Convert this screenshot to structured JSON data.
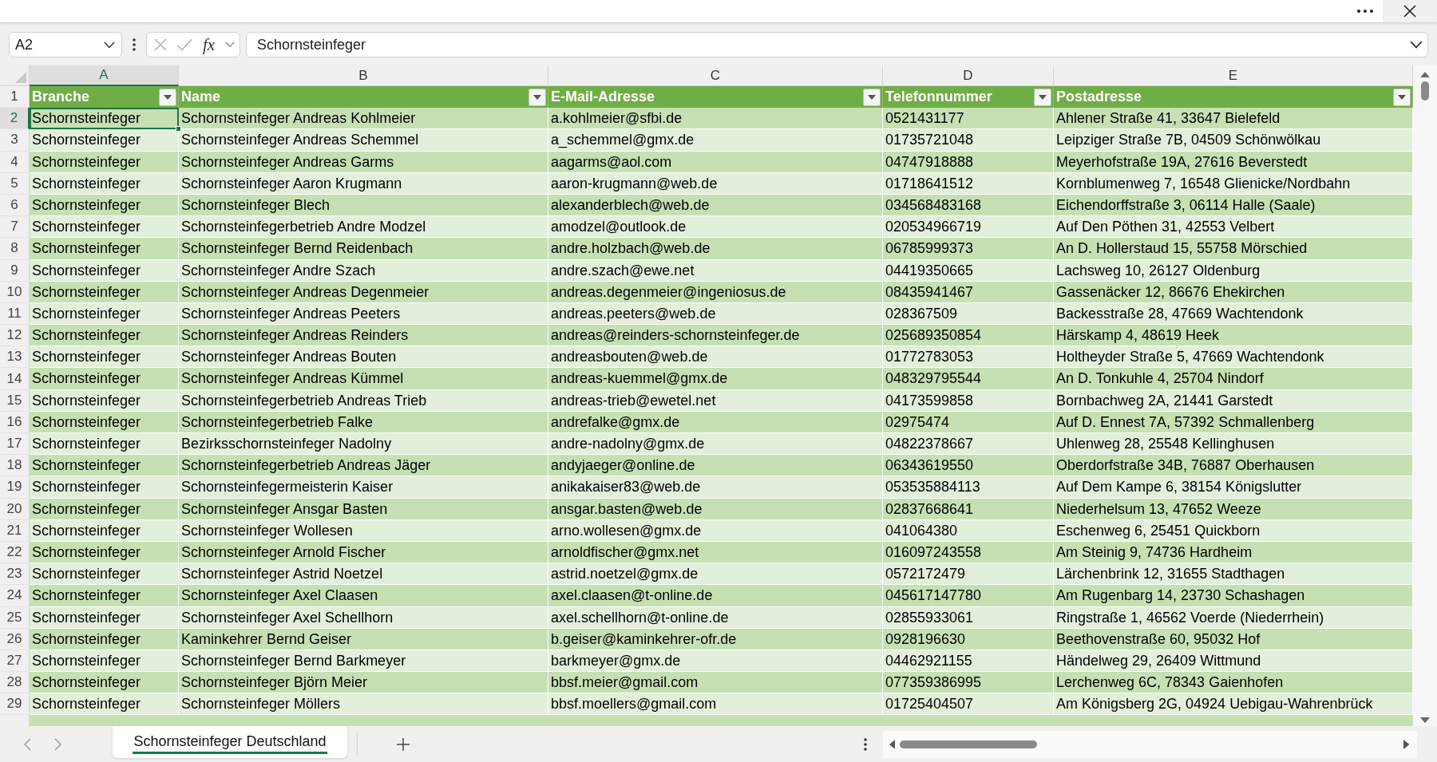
{
  "formula_bar": {
    "name_box": "A2",
    "function_label": "fx",
    "formula": "Schornsteinfeger"
  },
  "sheet": {
    "columns": [
      {
        "letter": "A",
        "selected": true
      },
      {
        "letter": "B",
        "selected": false
      },
      {
        "letter": "C",
        "selected": false
      },
      {
        "letter": "D",
        "selected": false
      },
      {
        "letter": "E",
        "selected": false
      }
    ],
    "header_row": {
      "number": "1",
      "labels": [
        "Branche",
        "Name",
        "E-Mail-Adresse",
        "Telefonnummer",
        "Postadresse"
      ]
    },
    "rows": [
      {
        "number": "2",
        "selected": true,
        "cells": [
          "Schornsteinfeger",
          "Schornsteinfeger Andreas Kohlmeier",
          "a.kohlmeier@sfbi.de",
          "0521431177",
          "Ahlener Straße 41, 33647 Bielefeld"
        ]
      },
      {
        "number": "3",
        "selected": false,
        "cells": [
          "Schornsteinfeger",
          "Schornsteinfeger Andreas Schemmel",
          "a_schemmel@gmx.de",
          "01735721048",
          "Leipziger Straße 7B, 04509 Schönwölkau"
        ]
      },
      {
        "number": "4",
        "selected": false,
        "cells": [
          "Schornsteinfeger",
          "Schornsteinfeger Andreas Garms",
          "aagarms@aol.com",
          "04747918888",
          "Meyerhofstraße 19A, 27616 Beverstedt"
        ]
      },
      {
        "number": "5",
        "selected": false,
        "cells": [
          "Schornsteinfeger",
          "Schornsteinfeger Aaron Krugmann",
          "aaron-krugmann@web.de",
          "01718641512",
          "Kornblumenweg 7, 16548 Glienicke/Nordbahn"
        ]
      },
      {
        "number": "6",
        "selected": false,
        "cells": [
          "Schornsteinfeger",
          "Schornsteinfeger Blech",
          "alexanderblech@web.de",
          "034568483168",
          "Eichendorffstraße 3, 06114 Halle (Saale)"
        ]
      },
      {
        "number": "7",
        "selected": false,
        "cells": [
          "Schornsteinfeger",
          "Schornsteinfegerbetrieb Andre Modzel",
          "amodzel@outlook.de",
          "020534966719",
          "Auf Den Pöthen 31, 42553 Velbert"
        ]
      },
      {
        "number": "8",
        "selected": false,
        "cells": [
          "Schornsteinfeger",
          "Schornsteinfeger Bernd Reidenbach",
          "andre.holzbach@web.de",
          "06785999373",
          "An D. Hollerstaud 15, 55758 Mörschied"
        ]
      },
      {
        "number": "9",
        "selected": false,
        "cells": [
          "Schornsteinfeger",
          "Schornsteinfeger Andre Szach",
          "andre.szach@ewe.net",
          "04419350665",
          "Lachsweg 10, 26127 Oldenburg"
        ]
      },
      {
        "number": "10",
        "selected": false,
        "cells": [
          "Schornsteinfeger",
          "Schornsteinfeger Andreas Degenmeier",
          "andreas.degenmeier@ingeniosus.de",
          "08435941467",
          "Gassenäcker 12, 86676 Ehekirchen"
        ]
      },
      {
        "number": "11",
        "selected": false,
        "cells": [
          "Schornsteinfeger",
          "Schornsteinfeger Andreas Peeters",
          "andreas.peeters@web.de",
          "028367509",
          "Backesstraße 28, 47669 Wachtendonk"
        ]
      },
      {
        "number": "12",
        "selected": false,
        "cells": [
          "Schornsteinfeger",
          "Schornsteinfeger Andreas Reinders",
          "andreas@reinders-schornsteinfeger.de",
          "025689350854",
          "Härskamp 4, 48619 Heek"
        ]
      },
      {
        "number": "13",
        "selected": false,
        "cells": [
          "Schornsteinfeger",
          "Schornsteinfeger Andreas Bouten",
          "andreasbouten@web.de",
          "01772783053",
          "Holtheyder Straße 5, 47669 Wachtendonk"
        ]
      },
      {
        "number": "14",
        "selected": false,
        "cells": [
          "Schornsteinfeger",
          "Schornsteinfeger Andreas Kümmel",
          "andreas-kuemmel@gmx.de",
          "048329795544",
          "An D. Tonkuhle 4, 25704 Nindorf"
        ]
      },
      {
        "number": "15",
        "selected": false,
        "cells": [
          "Schornsteinfeger",
          "Schornsteinfegerbetrieb Andreas Trieb",
          "andreas-trieb@ewetel.net",
          "04173599858",
          "Bornbachweg 2A, 21441 Garstedt"
        ]
      },
      {
        "number": "16",
        "selected": false,
        "cells": [
          "Schornsteinfeger",
          "Schornsteinfegerbetrieb Falke",
          "andrefalke@gmx.de",
          "02975474",
          "Auf D. Ennest 7A, 57392 Schmallenberg"
        ]
      },
      {
        "number": "17",
        "selected": false,
        "cells": [
          "Schornsteinfeger",
          "Bezirksschornsteinfeger Nadolny",
          "andre-nadolny@gmx.de",
          "04822378667",
          "Uhlenweg 28, 25548 Kellinghusen"
        ]
      },
      {
        "number": "18",
        "selected": false,
        "cells": [
          "Schornsteinfeger",
          "Schornsteinfegerbetrieb Andreas Jäger",
          "andyjaeger@online.de",
          "06343619550",
          "Oberdorfstraße 34B, 76887 Oberhausen"
        ]
      },
      {
        "number": "19",
        "selected": false,
        "cells": [
          "Schornsteinfeger",
          "Schornsteinfegermeisterin Kaiser",
          "anikakaiser83@web.de",
          "053535884113",
          "Auf Dem Kampe 6, 38154 Königslutter"
        ]
      },
      {
        "number": "20",
        "selected": false,
        "cells": [
          "Schornsteinfeger",
          "Schornsteinfeger Ansgar Basten",
          "ansgar.basten@web.de",
          "02837668641",
          "Niederhelsum 13, 47652 Weeze"
        ]
      },
      {
        "number": "21",
        "selected": false,
        "cells": [
          "Schornsteinfeger",
          "Schornsteinfeger Wollesen",
          "arno.wollesen@gmx.de",
          "041064380",
          "Eschenweg 6, 25451 Quickborn"
        ]
      },
      {
        "number": "22",
        "selected": false,
        "cells": [
          "Schornsteinfeger",
          "Schornsteinfeger Arnold Fischer",
          "arnoldfischer@gmx.net",
          "016097243558",
          "Am Steinig 9, 74736 Hardheim"
        ]
      },
      {
        "number": "23",
        "selected": false,
        "cells": [
          "Schornsteinfeger",
          "Schornsteinfeger Astrid Noetzel",
          "astrid.noetzel@gmx.de",
          "0572172479",
          "Lärchenbrink 12, 31655 Stadthagen"
        ]
      },
      {
        "number": "24",
        "selected": false,
        "cells": [
          "Schornsteinfeger",
          "Schornsteinfeger Axel Claasen",
          "axel.claasen@t-online.de",
          "045617147780",
          "Am Rugenbarg 14, 23730 Schashagen"
        ]
      },
      {
        "number": "25",
        "selected": false,
        "cells": [
          "Schornsteinfeger",
          "Schornsteinfeger Axel Schellhorn",
          "axel.schellhorn@t-online.de",
          "02855933061",
          "Ringstraße 1, 46562 Voerde (Niederrhein)"
        ]
      },
      {
        "number": "26",
        "selected": false,
        "cells": [
          "Schornsteinfeger",
          "Kaminkehrer Bernd Geiser",
          "b.geiser@kaminkehrer-ofr.de",
          "0928196630",
          "Beethovenstraße 60, 95032 Hof"
        ]
      },
      {
        "number": "27",
        "selected": false,
        "cells": [
          "Schornsteinfeger",
          "Schornsteinfeger Bernd Barkmeyer",
          "barkmeyer@gmx.de",
          "04462921155",
          "Händelweg 29, 26409 Wittmund"
        ]
      },
      {
        "number": "28",
        "selected": false,
        "cells": [
          "Schornsteinfeger",
          "Schornsteinfeger Björn Meier",
          "bbsf.meier@gmail.com",
          "077359386995",
          "Lerchenweg 6C, 78343 Gaienhofen"
        ]
      },
      {
        "number": "29",
        "selected": false,
        "cells": [
          "Schornsteinfeger",
          "Schornsteinfeger Möllers",
          "bbsf.moellers@gmail.com",
          "01725404507",
          "Am Königsberg 2G, 04924 Uebigau-Wahrenbrück"
        ]
      }
    ]
  },
  "sheet_tabs": [
    {
      "label": "Schornsteinfeger Deutschland",
      "selected": true
    }
  ]
}
